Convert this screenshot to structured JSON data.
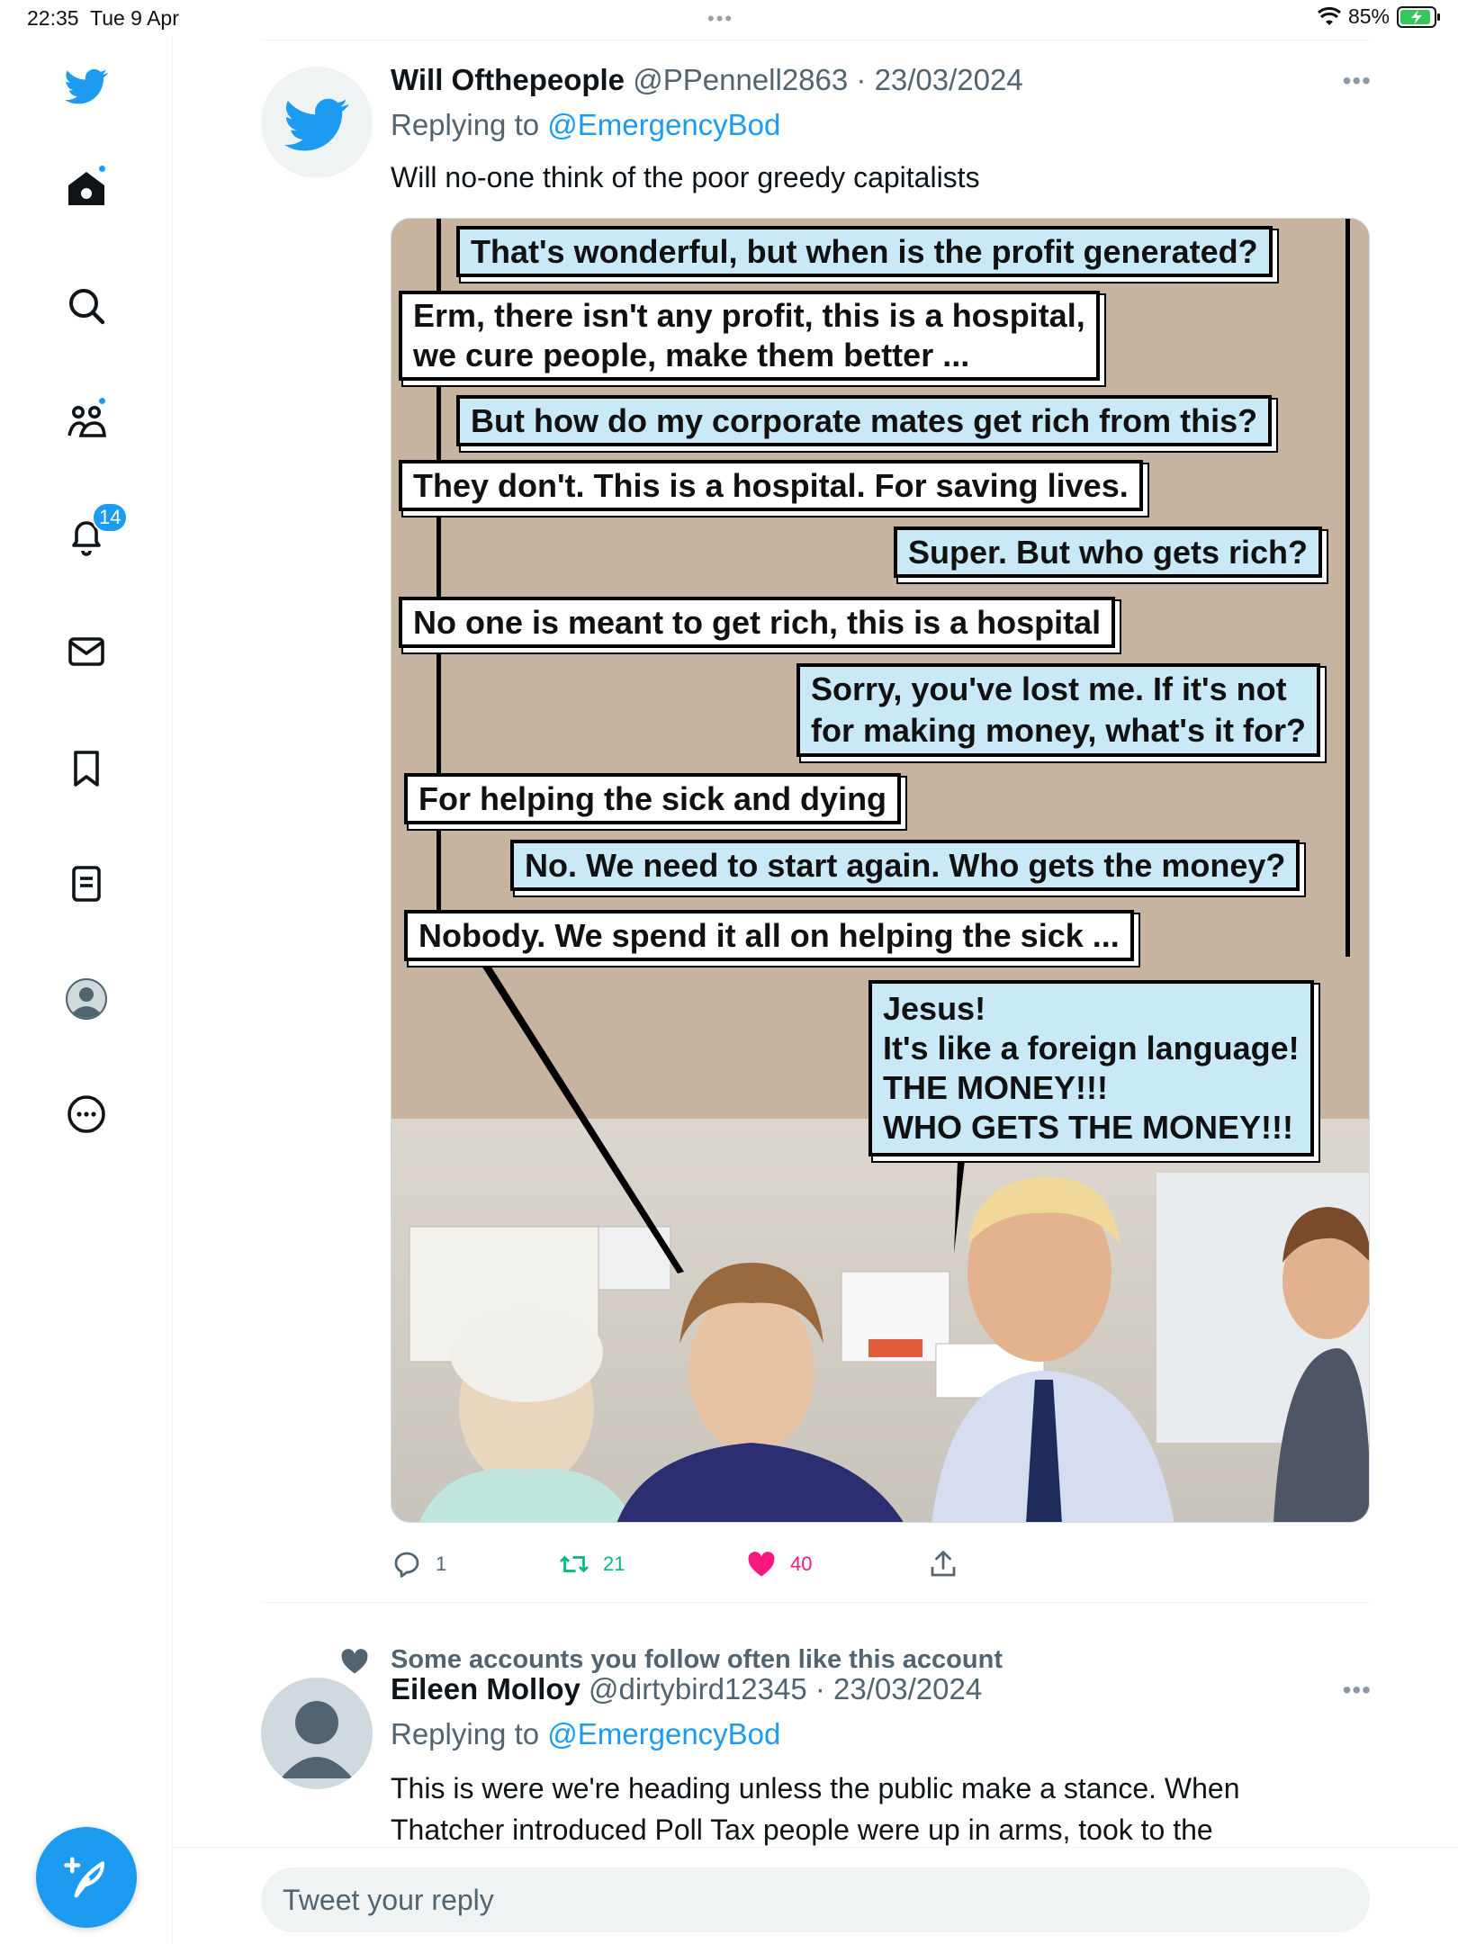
{
  "status_bar": {
    "time": "22:35",
    "date": "Tue 9 Apr",
    "battery": "85%"
  },
  "sidebar": {
    "items": [
      {
        "name": "home"
      },
      {
        "name": "explore"
      },
      {
        "name": "communities"
      },
      {
        "name": "notifications",
        "badge": "14"
      },
      {
        "name": "messages"
      },
      {
        "name": "bookmarks"
      },
      {
        "name": "lists"
      },
      {
        "name": "profile"
      },
      {
        "name": "more"
      }
    ]
  },
  "tweet1": {
    "name": "Will Ofthepeople",
    "handle": "@PPennell2863",
    "sep": " · ",
    "date": "23/03/2024",
    "replying_prefix": "Replying to ",
    "replying_to": "@EmergencyBod",
    "text": "Will no-one think of the poor greedy capitalists",
    "image": {
      "bubbles": [
        "That's wonderful, but when is the profit generated?",
        "Erm, there isn't any profit, this is a hospital,",
        "we cure people, make them better ...",
        "But how do my corporate mates get rich from this?",
        "They don't. This is a hospital. For saving lives.",
        "Super. But who gets rich?",
        "No one is meant to get rich, this is a hospital",
        "Sorry, you've lost me. If it's not",
        "for making money, what's it for?",
        "For helping the sick and dying",
        "No. We need to start again. Who gets the money?",
        "Nobody. We spend it all on helping the sick ...",
        "Jesus!",
        "It's like a foreign language!",
        "THE MONEY!!!",
        "WHO GETS THE MONEY!!!"
      ]
    },
    "stats": {
      "replies": "1",
      "retweets": "21",
      "likes": "40"
    }
  },
  "tweet2": {
    "social_context": "Some accounts you follow often like this account",
    "name": "Eileen Molloy",
    "handle": "@dirtybird12345",
    "sep": " · ",
    "date": "23/03/2024",
    "replying_prefix": "Replying to ",
    "replying_to": "@EmergencyBod",
    "text_line1": "This is were we're heading unless the public make a stance. When",
    "text_line2": "Thatcher introduced Poll Tax people were up in arms, took to the"
  },
  "reply_bar": {
    "placeholder": "Tweet your reply"
  },
  "colors": {
    "accent": "#1d9bf0",
    "like": "#f91880",
    "retweet": "#00ba7c",
    "muted": "#536471"
  }
}
